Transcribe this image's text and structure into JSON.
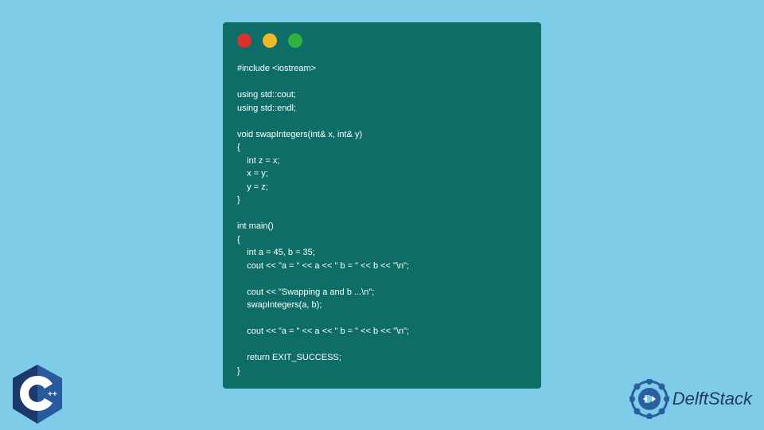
{
  "code": {
    "lines": [
      "#include <iostream>",
      "",
      "using std::cout;",
      "using std::endl;",
      "",
      "void swapIntegers(int& x, int& y)",
      "{",
      "    int z = x;",
      "    x = y;",
      "    y = z;",
      "}",
      "",
      "int main()",
      "{",
      "    int a = 45, b = 35;",
      "    cout << \"a = \" << a << \" b = \" << b << \"\\n\";",
      "",
      "    cout << \"Swapping a and b ...\\n\";",
      "    swapIntegers(a, b);",
      "",
      "    cout << \"a = \" << a << \" b = \" << b << \"\\n\";",
      "",
      "    return EXIT_SUCCESS;",
      "}"
    ]
  },
  "branding": {
    "delftstack_text": "DelftStack"
  },
  "window_controls": {
    "red": "#d9312e",
    "yellow": "#f0b929",
    "green": "#2fb243"
  }
}
